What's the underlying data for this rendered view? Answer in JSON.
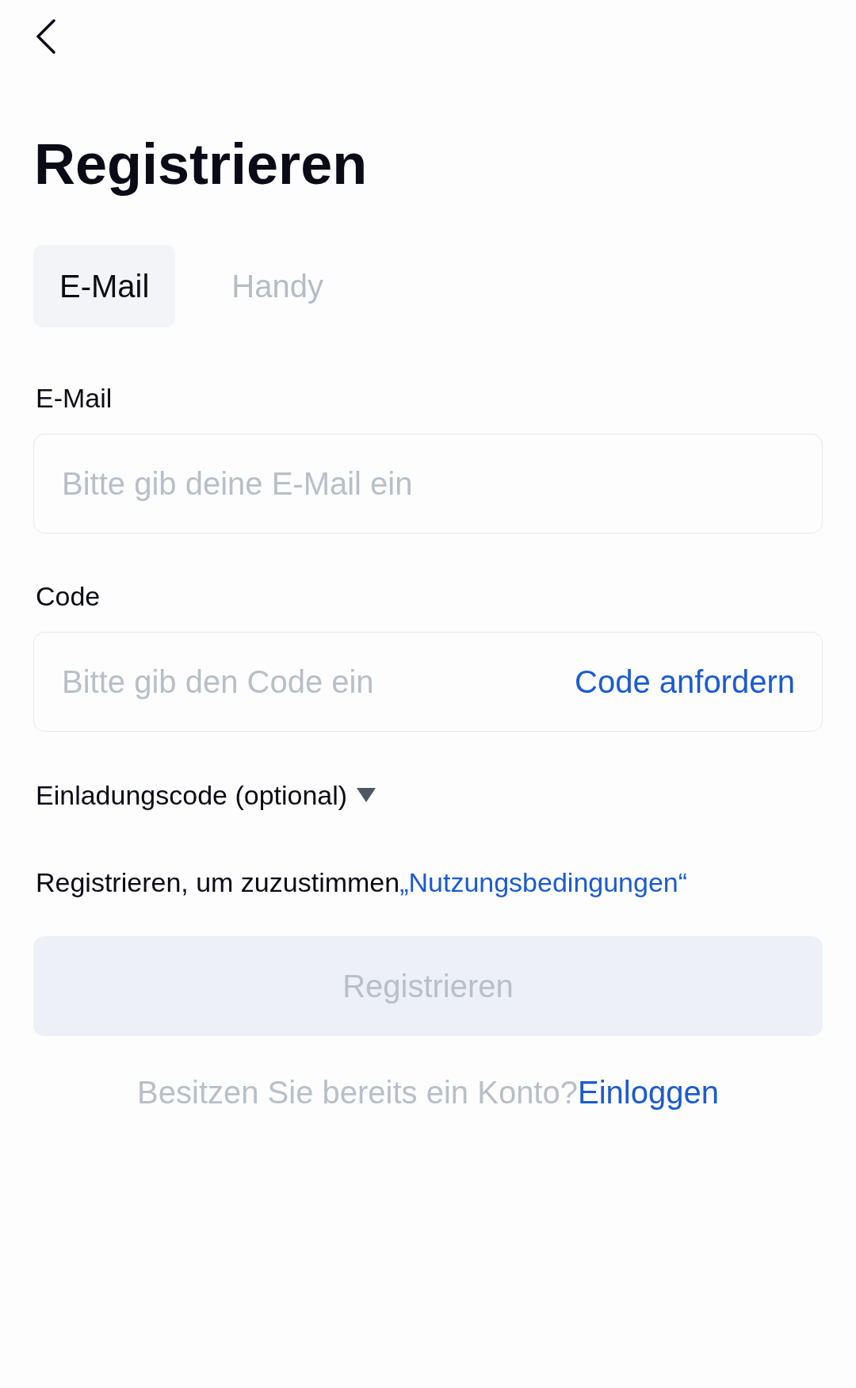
{
  "title": "Registrieren",
  "tabs": [
    {
      "label": "E-Mail",
      "selected": true
    },
    {
      "label": "Handy",
      "selected": false
    }
  ],
  "fields": [
    {
      "kind": "text",
      "label": "E-Mail",
      "placeholder": "Bitte gib deine E-Mail ein"
    },
    {
      "kind": "code",
      "label": "Code",
      "placeholder": "Bitte gib den Code ein",
      "action": "Code anfordern"
    }
  ],
  "invite_code": {
    "label": "Einladungscode (optional)",
    "expanded": false
  },
  "terms": {
    "text": "Registrieren, um zuzustimmen",
    "link": "„Nutzungsbedingungen“"
  },
  "register_button": {
    "label": "Registrieren",
    "disabled": true
  },
  "login_prompt": {
    "text": "Besitzen Sie bereits ein Konto?",
    "link": "Einloggen"
  }
}
